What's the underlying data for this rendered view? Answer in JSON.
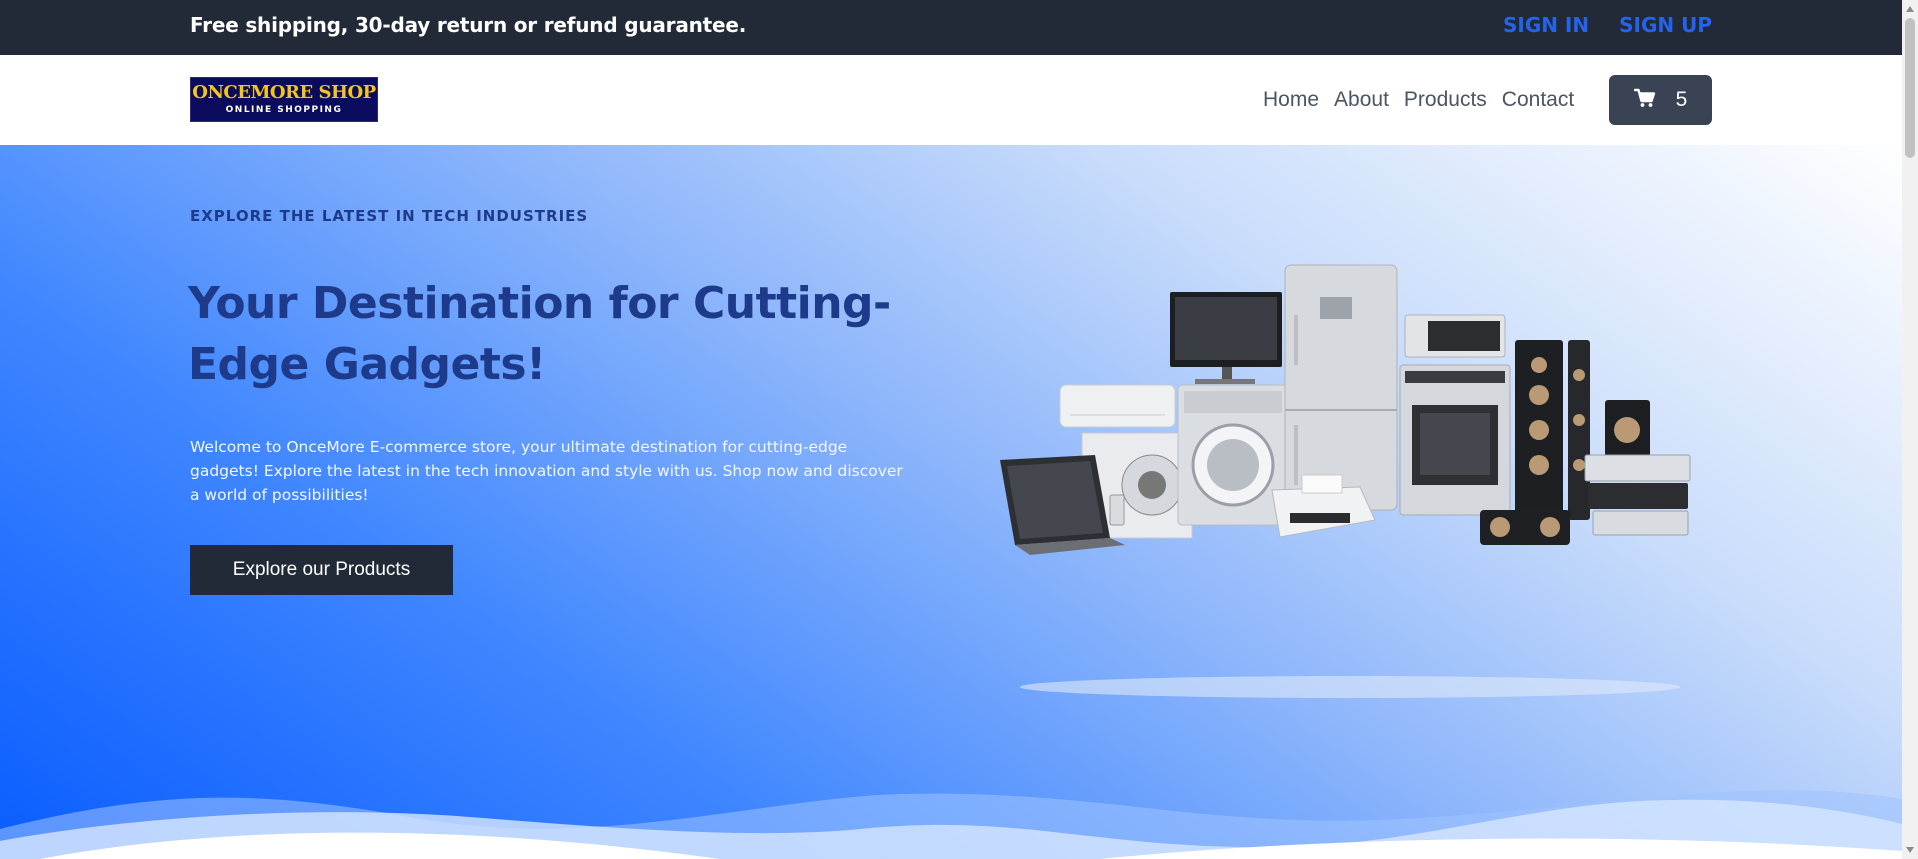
{
  "topbar": {
    "promo": "Free shipping, 30-day return or refund guarantee.",
    "sign_in": "SIGN IN",
    "sign_up": "SIGN UP"
  },
  "logo": {
    "line1": "ONCEMORE SHOP",
    "line2": "ONLINE SHOPPING"
  },
  "nav": {
    "items": [
      "Home",
      "About",
      "Products",
      "Contact"
    ],
    "cart_icon": "cart-icon",
    "cart_count": "5"
  },
  "hero": {
    "kicker": "EXPLORE THE LATEST IN TECH INDUSTRIES",
    "title": "Your Destination for Cutting-Edge Gadgets!",
    "description": "Welcome to OnceMore E-commerce store, your ultimate destination for cutting-edge gadgets! Explore the latest in the tech innovation and style with us. Shop now and discover a world of possibilities!",
    "cta": "Explore our Products"
  },
  "colors": {
    "topbar_bg": "#222a38",
    "auth_link": "#2563eb",
    "heading": "#1e3a8a",
    "cart_bg": "#3a4354",
    "logo_bg": "#0b0b5e",
    "logo_text": "#f5c518"
  }
}
